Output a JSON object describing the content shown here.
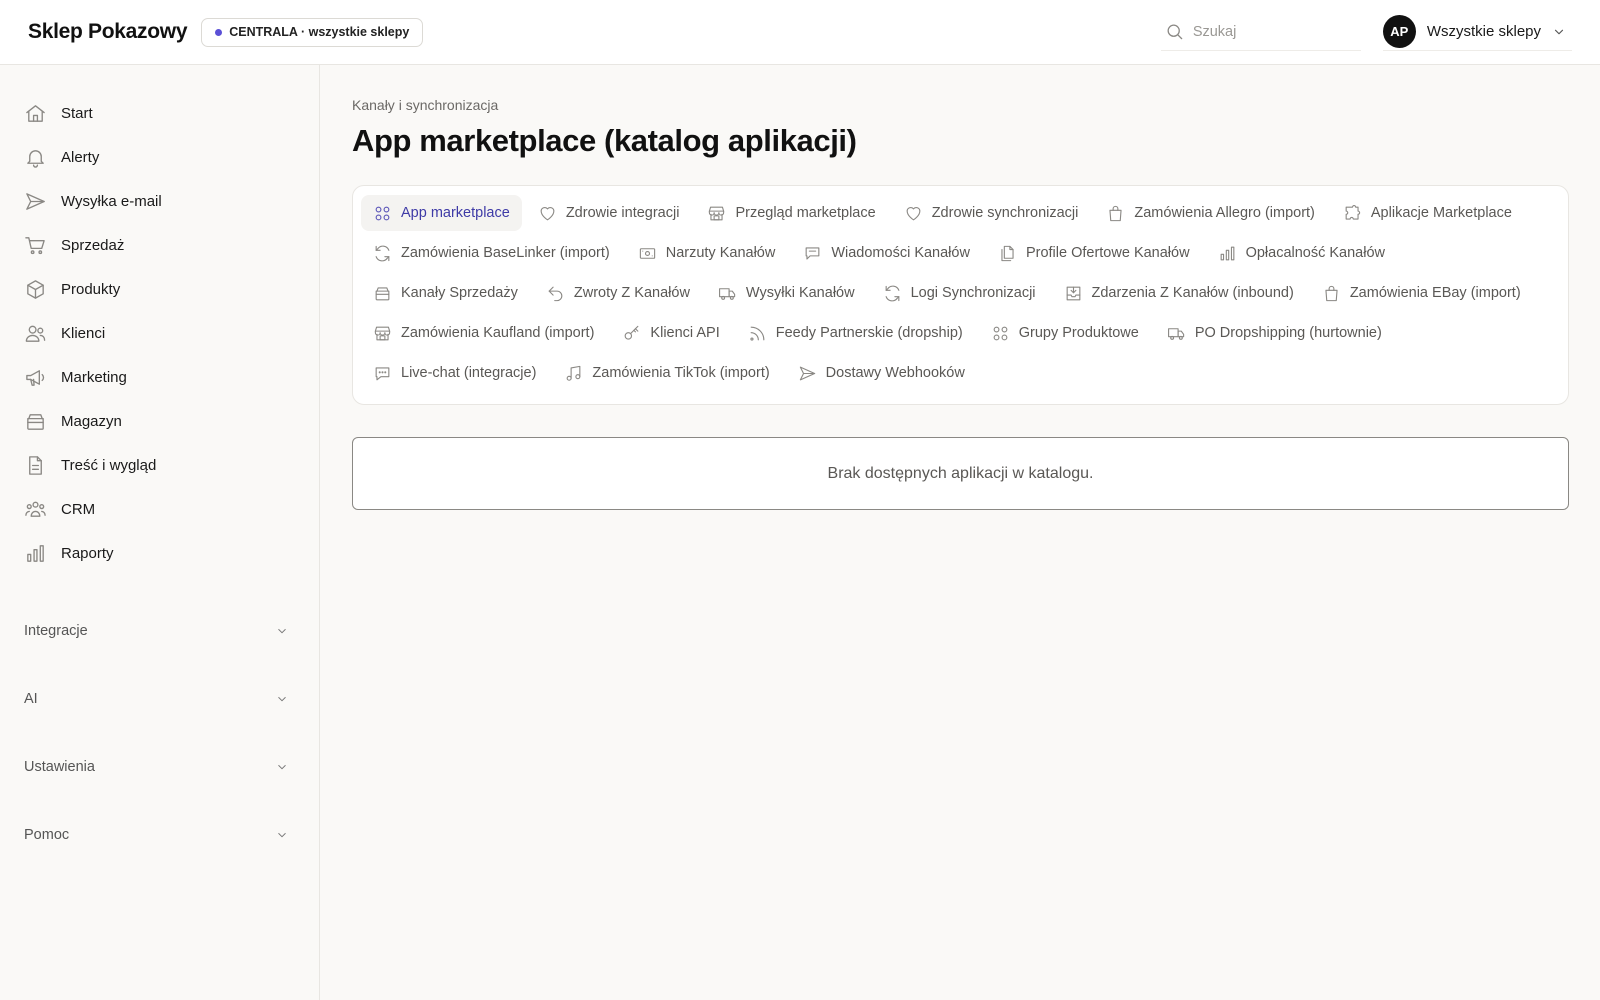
{
  "header": {
    "brand": "Sklep Pokazowy",
    "store_badge": "CENTRALA · wszystkie sklepy",
    "search_placeholder": "Szukaj",
    "avatar_initials": "AP",
    "store_selector": "Wszystkie sklepy"
  },
  "sidebar": {
    "items": [
      {
        "label": "Start",
        "icon": "home-icon"
      },
      {
        "label": "Alerty",
        "icon": "bell-icon"
      },
      {
        "label": "Wysyłka e-mail",
        "icon": "send-icon"
      },
      {
        "label": "Sprzedaż",
        "icon": "cart-icon"
      },
      {
        "label": "Produkty",
        "icon": "box-icon"
      },
      {
        "label": "Klienci",
        "icon": "users-icon"
      },
      {
        "label": "Marketing",
        "icon": "megaphone-icon"
      },
      {
        "label": "Magazyn",
        "icon": "archive-icon"
      },
      {
        "label": "Treść i wygląd",
        "icon": "document-icon"
      },
      {
        "label": "CRM",
        "icon": "group-icon"
      },
      {
        "label": "Raporty",
        "icon": "bar-chart-icon"
      }
    ],
    "sections": [
      "Integracje",
      "AI",
      "Ustawienia",
      "Pomoc"
    ]
  },
  "main": {
    "breadcrumb": "Kanały i synchronizacja",
    "title": "App marketplace (katalog aplikacji)",
    "tabs": [
      {
        "label": "App marketplace",
        "icon": "grid-icon",
        "active": true
      },
      {
        "label": "Zdrowie integracji",
        "icon": "heart-icon"
      },
      {
        "label": "Przegląd marketplace",
        "icon": "store-icon"
      },
      {
        "label": "Zdrowie synchronizacji",
        "icon": "heart-icon"
      },
      {
        "label": "Zamówienia Allegro (import)",
        "icon": "bag-icon"
      },
      {
        "label": "Aplikacje Marketplace",
        "icon": "puzzle-icon"
      },
      {
        "label": "Zamówienia BaseLinker (import)",
        "icon": "refresh-icon"
      },
      {
        "label": "Narzuty Kanałów",
        "icon": "cash-icon"
      },
      {
        "label": "Wiadomości Kanałów",
        "icon": "chat-icon"
      },
      {
        "label": "Profile Ofertowe Kanałów",
        "icon": "copy-icon"
      },
      {
        "label": "Opłacalność Kanałów",
        "icon": "bar-chart-icon"
      },
      {
        "label": "Kanały Sprzedaży",
        "icon": "archive-icon"
      },
      {
        "label": "Zwroty Z Kanałów",
        "icon": "undo-icon"
      },
      {
        "label": "Wysyłki Kanałów",
        "icon": "truck-icon"
      },
      {
        "label": "Logi Synchronizacji",
        "icon": "refresh-icon"
      },
      {
        "label": "Zdarzenia Z Kanałów (inbound)",
        "icon": "inbox-icon"
      },
      {
        "label": "Zamówienia EBay (import)",
        "icon": "bag-icon"
      },
      {
        "label": "Zamówienia Kaufland (import)",
        "icon": "store-icon"
      },
      {
        "label": "Klienci API",
        "icon": "key-icon"
      },
      {
        "label": "Feedy Partnerskie (dropship)",
        "icon": "rss-icon"
      },
      {
        "label": "Grupy Produktowe",
        "icon": "grid-icon"
      },
      {
        "label": "PO Dropshipping (hurtownie)",
        "icon": "truck-icon"
      },
      {
        "label": "Live-chat (integracje)",
        "icon": "chat-bubble-icon"
      },
      {
        "label": "Zamówienia TikTok (import)",
        "icon": "music-icon"
      },
      {
        "label": "Dostawy Webhooków",
        "icon": "send-icon"
      }
    ],
    "empty_message": "Brak dostępnych aplikacji w katalogu."
  },
  "colors": {
    "accent": "#3e3aa6",
    "badge_dot": "#5b50d6"
  }
}
